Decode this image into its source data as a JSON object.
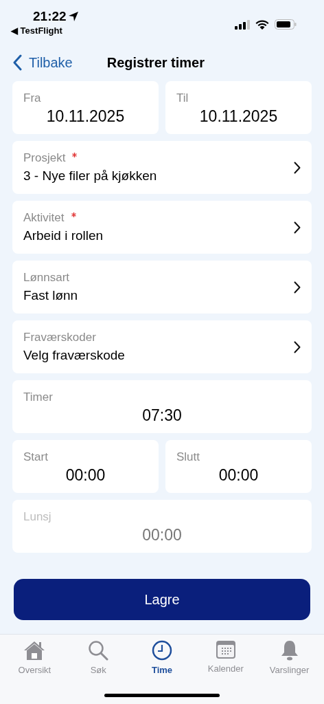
{
  "status_bar": {
    "time": "21:22",
    "back_app": "◀ TestFlight"
  },
  "nav": {
    "back": "Tilbake",
    "title": "Registrer timer"
  },
  "rows": [
    {
      "kind": "pair",
      "cells": [
        {
          "label": "Fra",
          "value": "10.11.2025"
        },
        {
          "label": "Til",
          "value": "10.11.2025"
        }
      ]
    },
    {
      "kind": "picker",
      "label": "Prosjekt",
      "value": "3 - Nye filer på kjøkken",
      "required": true
    },
    {
      "kind": "picker",
      "label": "Aktivitet",
      "value": "Arbeid i rollen",
      "required": true
    },
    {
      "kind": "picker",
      "label": "Lønnsart",
      "value": "Fast lønn",
      "required": false
    },
    {
      "kind": "picker",
      "label": "Fraværskoder",
      "value": "Velg fraværskode",
      "required": false
    },
    {
      "kind": "time",
      "label": "Timer",
      "value": "07:30",
      "disabled": false
    },
    {
      "kind": "pair",
      "cells": [
        {
          "label": "Start",
          "value": "00:00"
        },
        {
          "label": "Slutt",
          "value": "00:00"
        }
      ]
    },
    {
      "kind": "time",
      "label": "Lunsj",
      "value": "00:00",
      "disabled": true
    }
  ],
  "save_button": "Lagre",
  "tabs": [
    {
      "label": "Oversikt",
      "selected": false
    },
    {
      "label": "Søk",
      "selected": false
    },
    {
      "label": "Time",
      "selected": true
    },
    {
      "label": "Kalender",
      "selected": false
    },
    {
      "label": "Varslinger",
      "selected": false
    }
  ]
}
